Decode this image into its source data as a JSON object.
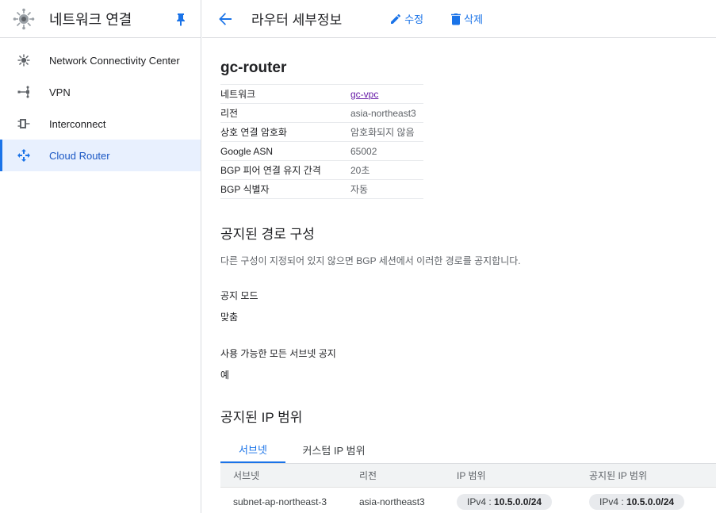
{
  "sidebar": {
    "title": "네트워크 연결",
    "items": [
      {
        "label": "Network Connectivity Center",
        "icon": "hub-icon"
      },
      {
        "label": "VPN",
        "icon": "vpn-icon"
      },
      {
        "label": "Interconnect",
        "icon": "interconnect-icon"
      },
      {
        "label": "Cloud Router",
        "icon": "cloud-router-icon",
        "active": true
      }
    ]
  },
  "topbar": {
    "title": "라우터 세부정보",
    "edit_label": "수정",
    "delete_label": "삭제"
  },
  "router": {
    "name": "gc-router",
    "properties": [
      {
        "key": "네트워크",
        "value": "gc-vpc",
        "link": true
      },
      {
        "key": "리전",
        "value": "asia-northeast3"
      },
      {
        "key": "상호 연결 암호화",
        "value": "암호화되지 않음"
      },
      {
        "key": "Google ASN",
        "value": "65002"
      },
      {
        "key": "BGP 피어 연결 유지 간격",
        "value": "20초"
      },
      {
        "key": "BGP 식별자",
        "value": "자동"
      }
    ]
  },
  "advertised_routes": {
    "title": "공지된 경로 구성",
    "description": "다른 구성이 지정되어 있지 않으면 BGP 세션에서 이러한 경로를 공지합니다.",
    "mode_label": "공지 모드",
    "mode_value": "맞춤",
    "subnets_label": "사용 가능한 모든 서브넷 공지",
    "subnets_value": "예"
  },
  "advertised_ip": {
    "title": "공지된 IP 범위",
    "tabs": [
      "서브넷",
      "커스텀 IP 범위"
    ],
    "columns": [
      "서브넷",
      "리전",
      "IP 범위",
      "공지된 IP 범위"
    ],
    "rows": [
      {
        "subnet": "subnet-ap-northeast-3",
        "region": "asia-northeast3",
        "ip_prefix": "IPv4 : ",
        "ip_range": "10.5.0.0/24",
        "adv_prefix": "IPv4 : ",
        "adv_range": "10.5.0.0/24"
      }
    ]
  },
  "colors": {
    "accent": "#1a73e8",
    "link_visited": "#681da8",
    "chip_bg": "#e8eaed"
  }
}
